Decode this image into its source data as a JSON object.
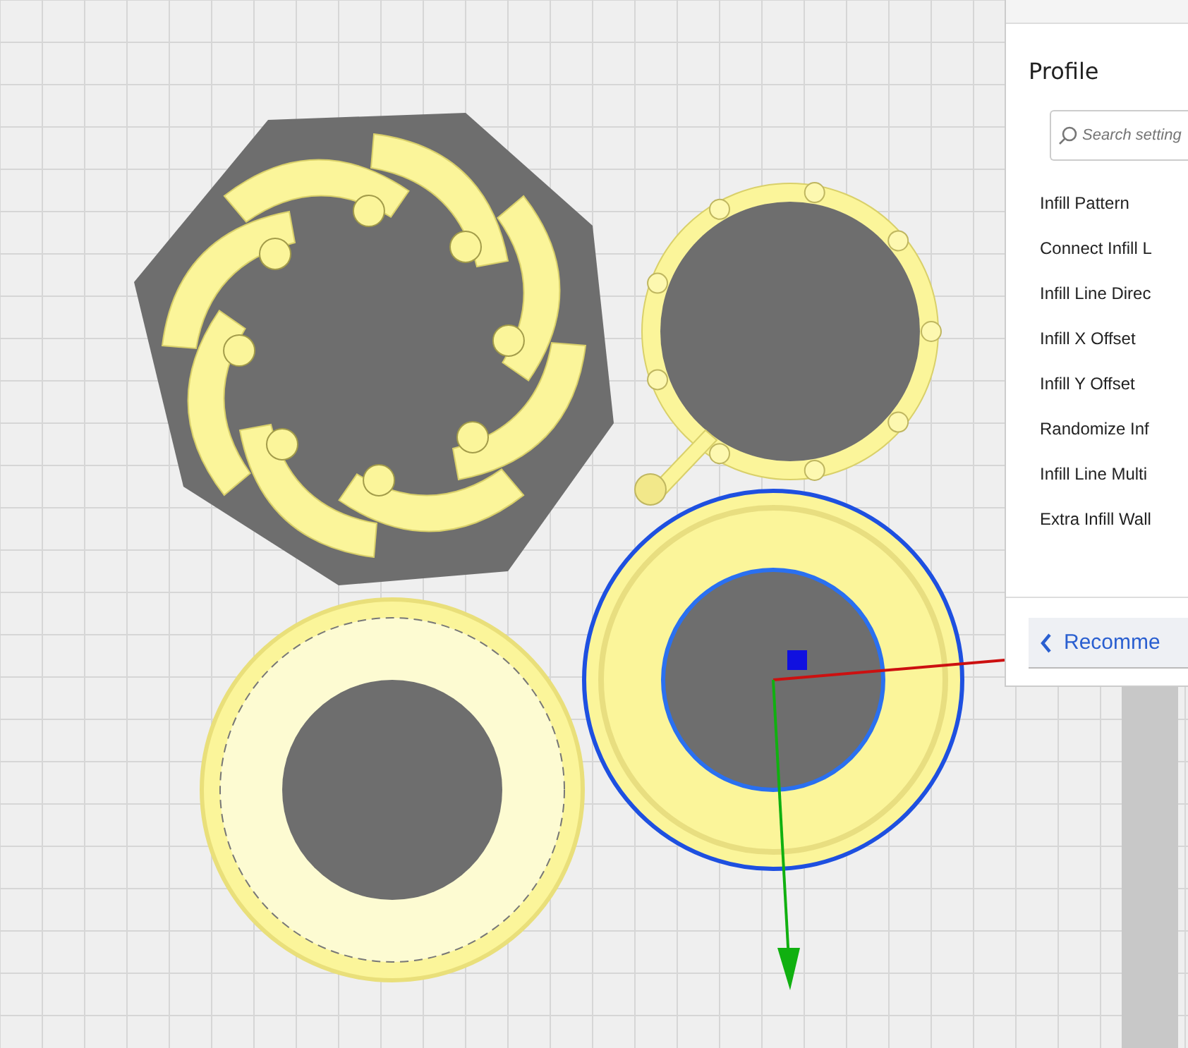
{
  "panel": {
    "title": "Profile",
    "search": {
      "placeholder": "Search setting"
    },
    "settings": [
      {
        "label": "Infill Pattern"
      },
      {
        "label": "Connect Infill L"
      },
      {
        "label": "Infill Line Direc"
      },
      {
        "label": "Infill X Offset"
      },
      {
        "label": "Infill Y Offset"
      },
      {
        "label": "Randomize Inf"
      },
      {
        "label": "Infill Line Multi"
      },
      {
        "label": "Extra Infill Wall"
      }
    ],
    "back_button": {
      "label": "Recomme"
    }
  }
}
